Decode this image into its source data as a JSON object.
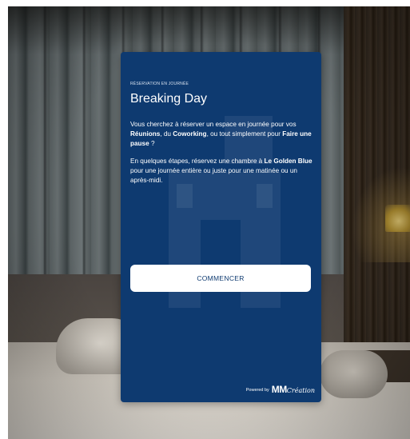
{
  "card": {
    "eyebrow": "RÉSERVATION EN JOURNÉE",
    "title": "Breaking Day",
    "paragraph1": {
      "t1": "Vous cherchez à réserver un espace en journée pour vos ",
      "b1": "Réunions",
      "t2": ", du ",
      "b2": "Coworking",
      "t3": ", ou tout simplement pour ",
      "b3": "Faire une pause",
      "t4": " ?"
    },
    "paragraph2": {
      "t1": "En quelques étapes, réservez une chambre à ",
      "b1": "Le Golden Blue",
      "t2": " pour une journée entière ou juste pour une matinée ou un après-midi."
    },
    "start_button_label": "COMMENCER",
    "powered_by": "Powered by",
    "logo": {
      "mm": "MM",
      "creation": "Création"
    }
  },
  "colors": {
    "card_background": "#0e3a70",
    "button_background": "#ffffff",
    "button_text": "#0e3a70"
  },
  "icons": {
    "watermark": "building-watermark-icon"
  }
}
